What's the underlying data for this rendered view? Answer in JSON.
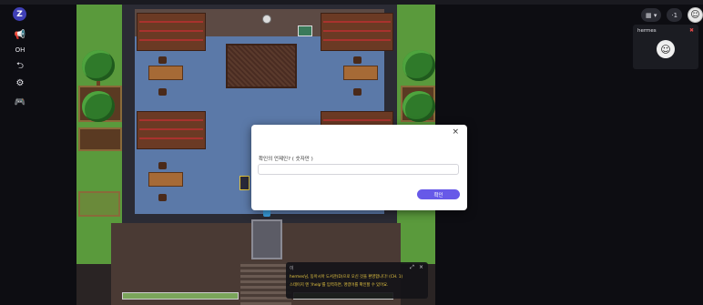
{
  "sidebar": {
    "logo_glyph": "Z",
    "items": [
      {
        "name": "megaphone-icon",
        "glyph": "📢"
      },
      {
        "name": "oh-label",
        "label": "OH"
      },
      {
        "name": "exit-icon",
        "glyph": "⮌"
      },
      {
        "name": "gear-icon",
        "glyph": "⚙"
      },
      {
        "name": "gamepad-icon",
        "glyph": "🎮"
      }
    ]
  },
  "top_controls": {
    "layout_label": "▦ ▾",
    "users_label": "·1",
    "avatar_glyph": "☺"
  },
  "video_tile": {
    "name": "hermes",
    "mic_muted_glyph": "✖",
    "avatar_glyph": "☺"
  },
  "modal": {
    "close_glyph": "×",
    "label": "확인의 언제인? ( 숫자만 )",
    "input_value": "",
    "input_placeholder": "",
    "submit_label": "확인"
  },
  "chat": {
    "badge": "이",
    "expand_glyph": "⤢",
    "close_glyph": "×",
    "lines": [
      "hermes님, 동아시아 도서관(D)으로 오신 것을 환영합니다! (CH. 1)",
      "스테이지 엔 '/help'를 입력하면, 명령어를 확인할 수 있어요."
    ]
  },
  "colors": {
    "accent": "#6759e8",
    "grass": "#5a9a3c",
    "floor": "#5b79a8",
    "chat_text": "#e8c843"
  }
}
